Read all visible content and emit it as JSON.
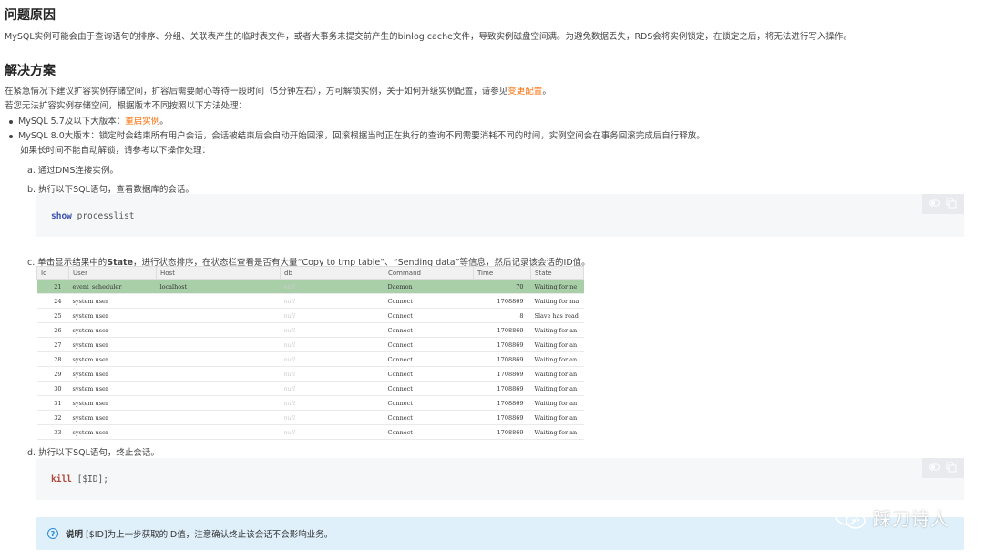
{
  "section1": {
    "title": "问题原因",
    "text": "MySQL实例可能会由于查询语句的排序、分组、关联表产生的临时表文件，或者大事务未提交前产生的binlog cache文件，导致实例磁盘空间满。为避免数据丢失，RDS会将实例锁定，在锁定之后，将无法进行写入操作。"
  },
  "section2": {
    "title": "解决方案",
    "line1_prefix": "在紧急情况下建议扩容实例存储空间，扩容后需要耐心等待一段时间（5分钟左右），方可解锁实例，关于如何升级实例配置，请参见",
    "line1_link": "变更配置",
    "line1_suffix": "。",
    "line2": "若您无法扩容实例存储空间，根据版本不同按照以下方法处理：",
    "bullet1_prefix": "MySQL 5.7及以下大版本：",
    "bullet1_link": "重启实例",
    "bullet1_suffix": "。",
    "bullet2": "MySQL 8.0大版本：锁定时会结束所有用户会话，会话被结束后会自动开始回滚，回滚根据当时正在执行的查询不同需要消耗不同的时间，实例空间会在事务回滚完成后自行释放。",
    "bullet2_sub": "如果长时间不能自动解锁，请参考以下操作处理：",
    "step_a": "a. 通过DMS连接实例。",
    "step_b": "b. 执行以下SQL语句，查看数据库的会话。",
    "code1_kw": "show",
    "code1_rest": " processlist",
    "step_c_prefix": "c. 单击显示结果中的",
    "step_c_bold": "State",
    "step_c_suffix": "，进行状态排序，在状态栏查看是否有大量“Copy to tmp table”、“Sending data”等信息，然后记录该会话的ID值。",
    "step_d": "d. 执行以下SQL语句，终止会话。",
    "code2_kw": "kill",
    "code2_rest": " [$ID];",
    "note_bold": "说明",
    "note_text": " [$ID]为上一步获取的ID值，注意确认终止该会话不会影响业务。",
    "note_icon_glyph": "?"
  },
  "table": {
    "headers": [
      "Id",
      "User",
      "Host",
      "db",
      "Command",
      "Time",
      "State"
    ],
    "null_text": "null",
    "rows": [
      {
        "id": "21",
        "user": "event_scheduler",
        "host": "localhost",
        "command": "Daemon",
        "time": "70",
        "state": "Waiting for ne",
        "selected": true
      },
      {
        "id": "24",
        "user": "system user",
        "host": "",
        "command": "Connect",
        "time": "1708869",
        "state": "Waiting for ma"
      },
      {
        "id": "25",
        "user": "system user",
        "host": "",
        "command": "Connect",
        "time": "8",
        "state": "Slave has read"
      },
      {
        "id": "26",
        "user": "system user",
        "host": "",
        "command": "Connect",
        "time": "1708869",
        "state": "Waiting for an"
      },
      {
        "id": "27",
        "user": "system user",
        "host": "",
        "command": "Connect",
        "time": "1708869",
        "state": "Waiting for an"
      },
      {
        "id": "28",
        "user": "system user",
        "host": "",
        "command": "Connect",
        "time": "1708869",
        "state": "Waiting for an"
      },
      {
        "id": "29",
        "user": "system user",
        "host": "",
        "command": "Connect",
        "time": "1708869",
        "state": "Waiting for an"
      },
      {
        "id": "30",
        "user": "system user",
        "host": "",
        "command": "Connect",
        "time": "1708869",
        "state": "Waiting for an"
      },
      {
        "id": "31",
        "user": "system user",
        "host": "",
        "command": "Connect",
        "time": "1708869",
        "state": "Waiting for an"
      },
      {
        "id": "32",
        "user": "system user",
        "host": "",
        "command": "Connect",
        "time": "1708869",
        "state": "Waiting for an"
      },
      {
        "id": "33",
        "user": "system user",
        "host": "",
        "command": "Connect",
        "time": "1708869",
        "state": "Waiting for an"
      }
    ]
  },
  "watermark": {
    "text": "踩刀诗人",
    "icon": "wechat-icon"
  },
  "colors": {
    "link": "#ff6a00",
    "selected_row": "#a8cfa8",
    "note_bg": "#dff0fb",
    "code_bg": "#f6f7f9"
  }
}
